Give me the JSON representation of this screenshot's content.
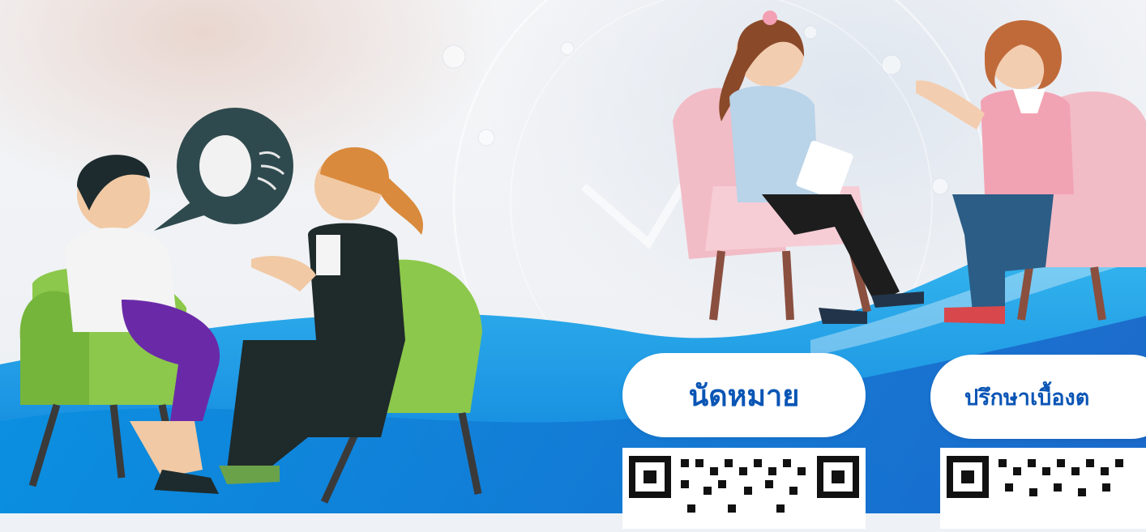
{
  "buttons": {
    "appointment_label": "นัดหมาย",
    "consult_label": "ปรึกษาเบื้องต"
  },
  "colors": {
    "brand_blue": "#0a55b5",
    "wave_blue": "#1aa6e8",
    "wave_light": "#5fd0f5",
    "chair_green": "#8cc84b",
    "chair_pink": "#f2bcc6"
  },
  "icons": {
    "speech_bubble": "speech-bubble-icon",
    "qr_code": "qr-code-icon"
  }
}
